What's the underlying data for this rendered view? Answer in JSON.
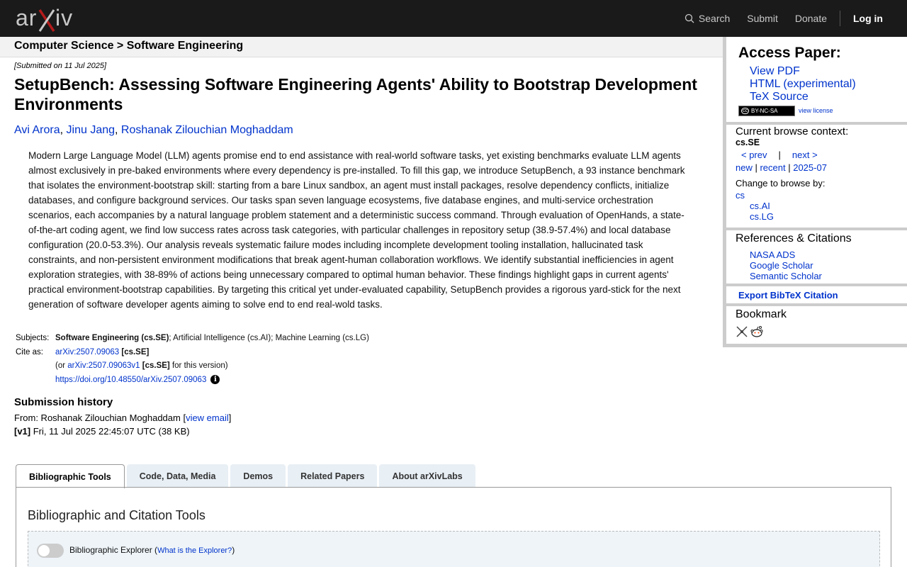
{
  "header": {
    "logo_text": "arXiv",
    "search_label": "Search",
    "submit_label": "Submit",
    "donate_label": "Donate",
    "login_label": "Log in"
  },
  "breadcrumb": "Computer Science > Software Engineering",
  "paper": {
    "submitted": "[Submitted on 11 Jul 2025]",
    "title": "SetupBench: Assessing Software Engineering Agents' Ability to Bootstrap Development Environments",
    "authors": [
      "Avi Arora",
      "Jinu Jang",
      "Roshanak Zilouchian Moghaddam"
    ],
    "abstract": "Modern Large Language Model (LLM) agents promise end to end assistance with real-world software tasks, yet existing benchmarks evaluate LLM agents almost exclusively in pre-baked environments where every dependency is pre-installed. To fill this gap, we introduce SetupBench, a 93 instance benchmark that isolates the environment-bootstrap skill: starting from a bare Linux sandbox, an agent must install packages, resolve dependency conflicts, initialize databases, and configure background services. Our tasks span seven language ecosystems, five database engines, and multi-service orchestration scenarios, each accompanies by a natural language problem statement and a deterministic success command. Through evaluation of OpenHands, a state-of-the-art coding agent, we find low success rates across task categories, with particular challenges in repository setup (38.9-57.4%) and local database configuration (20.0-53.3%). Our analysis reveals systematic failure modes including incomplete development tooling installation, hallucinated task constraints, and non-persistent environment modifications that break agent-human collaboration workflows. We identify substantial inefficiencies in agent exploration strategies, with 38-89% of actions being unnecessary compared to optimal human behavior. These findings highlight gaps in current agents' practical environment-bootstrap capabilities. By targeting this critical yet under-evaluated capability, SetupBench provides a rigorous yard-stick for the next generation of software developer agents aiming to solve end to end real-wold tasks."
  },
  "meta": {
    "subjects_label": "Subjects:",
    "subjects_primary": "Software Engineering (cs.SE)",
    "subjects_rest": "; Artificial Intelligence (cs.AI); Machine Learning (cs.LG)",
    "cite_label": "Cite as:",
    "cite_id": "arXiv:2507.09063",
    "cite_tag": "[cs.SE]",
    "version_prefix": "(or ",
    "version_id": "arXiv:2507.09063v1",
    "version_tag": "[cs.SE]",
    "version_suffix": " for this version)",
    "doi": "https://doi.org/10.48550/arXiv.2507.09063"
  },
  "history": {
    "title": "Submission history",
    "from_prefix": "From: Roshanak Zilouchian Moghaddam [",
    "view_email": "view email",
    "from_suffix": "]",
    "version_label": "[v1]",
    "version_info": " Fri, 11 Jul 2025 22:45:07 UTC (38 KB)"
  },
  "tabs": [
    {
      "label": "Bibliographic Tools",
      "active": true
    },
    {
      "label": "Code, Data, Media"
    },
    {
      "label": "Demos"
    },
    {
      "label": "Related Papers"
    },
    {
      "label": "About arXivLabs"
    }
  ],
  "panel": {
    "title": "Bibliographic and Citation Tools",
    "explorer_label": "Bibliographic Explorer (",
    "explorer_link": "What is the Explorer?",
    "explorer_close": ")",
    "toggle_on": false
  },
  "sidebar": {
    "access_title": "Access Paper:",
    "access_links": [
      "View PDF",
      "HTML (experimental)",
      "TeX Source"
    ],
    "license_badge": "BY-NC-SA",
    "license_cc": "cc",
    "view_license": "view license",
    "context_title": "Current browse context:",
    "context_sub": "cs.SE",
    "prev": "< prev",
    "sep": "|",
    "next": "next >",
    "list_new": "new",
    "list_recent": "recent",
    "list_month": "2025-07",
    "list_sep": " | ",
    "change_label": "Change to browse by:",
    "cat_main": "cs",
    "cat_subs": [
      "cs.AI",
      "cs.LG"
    ],
    "refs_title": "References & Citations",
    "refs_links": [
      "NASA ADS",
      "Google Scholar",
      "Semantic Scholar"
    ],
    "export_label": "Export BibTeX Citation",
    "bookmark_title": "Bookmark"
  },
  "colors": {
    "header_bg": "#1a1a1a",
    "link": "#0033cc",
    "logo_x": "#b31b1b"
  }
}
